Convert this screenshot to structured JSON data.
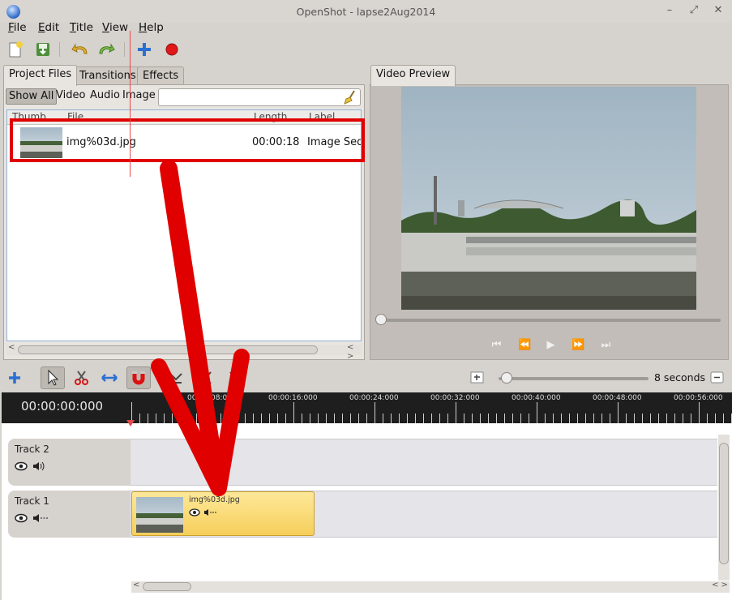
{
  "window": {
    "title": "OpenShot - lapse2Aug2014",
    "minimize": "–",
    "restore": "⤢",
    "close": "✕"
  },
  "menu": [
    "File",
    "Edit",
    "Title",
    "View",
    "Help"
  ],
  "tabs": {
    "project_files": "Project Files",
    "transitions": "Transitions",
    "effects": "Effects",
    "video_preview": "Video Preview"
  },
  "filters": [
    "Show All",
    "Video",
    "Audio",
    "Image"
  ],
  "search": {
    "placeholder": ""
  },
  "file_list": {
    "columns": [
      "Thumb",
      "File",
      "Length",
      "Label"
    ],
    "rows": [
      {
        "file": "img%03d.jpg",
        "length": "00:00:18",
        "label": "Image Sequ"
      }
    ]
  },
  "preview_controls": [
    "⏮",
    "⏪",
    "▶",
    "⏩",
    "⏭"
  ],
  "timeline": {
    "timecode": "00:00:00:000",
    "zoom_label": "8 seconds",
    "zoom_level": 0.05,
    "ruler_labels": [
      "00:00:08:000",
      "00:00:16:000",
      "00:00:24:000",
      "00:00:32:000",
      "00:00:40:000",
      "00:00:48:000",
      "00:00:56:000"
    ],
    "tracks": [
      {
        "name": "Track 2"
      },
      {
        "name": "Track 1"
      }
    ],
    "clip": {
      "name": "img%03d.jpg"
    }
  },
  "colors": {
    "annotation_red": "#e00000",
    "clip_fill": "#f6cf5b",
    "timeline_ruler": "#1e1e1e"
  }
}
